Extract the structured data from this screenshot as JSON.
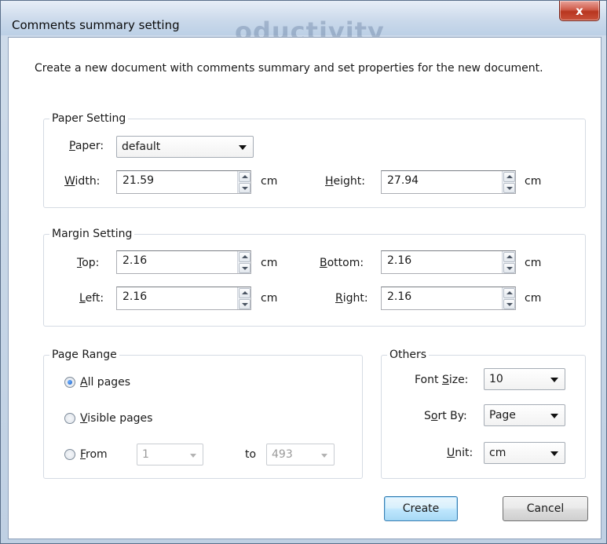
{
  "window": {
    "title": "Comments summary setting",
    "background_text": "oductivity",
    "close_glyph": "x"
  },
  "description": "Create a new document with comments summary and set properties for the new document.",
  "paper_setting": {
    "title": "Paper Setting",
    "paper_label_ul": "P",
    "paper_label_rest": "aper:",
    "paper_value": "default",
    "width_label_ul": "W",
    "width_label_rest": "idth:",
    "width_value": "21.59",
    "height_label_ul": "H",
    "height_label_rest": "eight:",
    "height_value": "27.94",
    "unit": "cm"
  },
  "margin_setting": {
    "title": "Margin Setting",
    "top_label_ul": "T",
    "top_label_rest": "op:",
    "top_value": "2.16",
    "bottom_label_ul": "B",
    "bottom_label_rest": "ottom:",
    "bottom_value": "2.16",
    "left_label_ul": "L",
    "left_label_rest": "eft:",
    "left_value": "2.16",
    "right_label_ul": "R",
    "right_label_rest": "ight:",
    "right_value": "2.16",
    "unit": "cm"
  },
  "page_range": {
    "title": "Page Range",
    "all_ul": "A",
    "all_rest": "ll pages",
    "visible_ul": "V",
    "visible_rest": "isible pages",
    "from_ul": "F",
    "from_rest": "rom",
    "from_value": "1",
    "to_label": "to",
    "to_value": "493",
    "selected": "all"
  },
  "others": {
    "title": "Others",
    "font_size_label_a": "Font ",
    "font_size_label_ul": "S",
    "font_size_label_b": "ize:",
    "font_size_value": "10",
    "sort_by_label_a": "S",
    "sort_by_label_ul": "o",
    "sort_by_label_b": "rt By:",
    "sort_by_value": "Page",
    "unit_label_ul": "U",
    "unit_label_rest": "nit:",
    "unit_value": "cm"
  },
  "buttons": {
    "create": "Create",
    "cancel": "Cancel"
  },
  "colors": {
    "accent": "#3c7fb1",
    "close": "#c9513a"
  }
}
